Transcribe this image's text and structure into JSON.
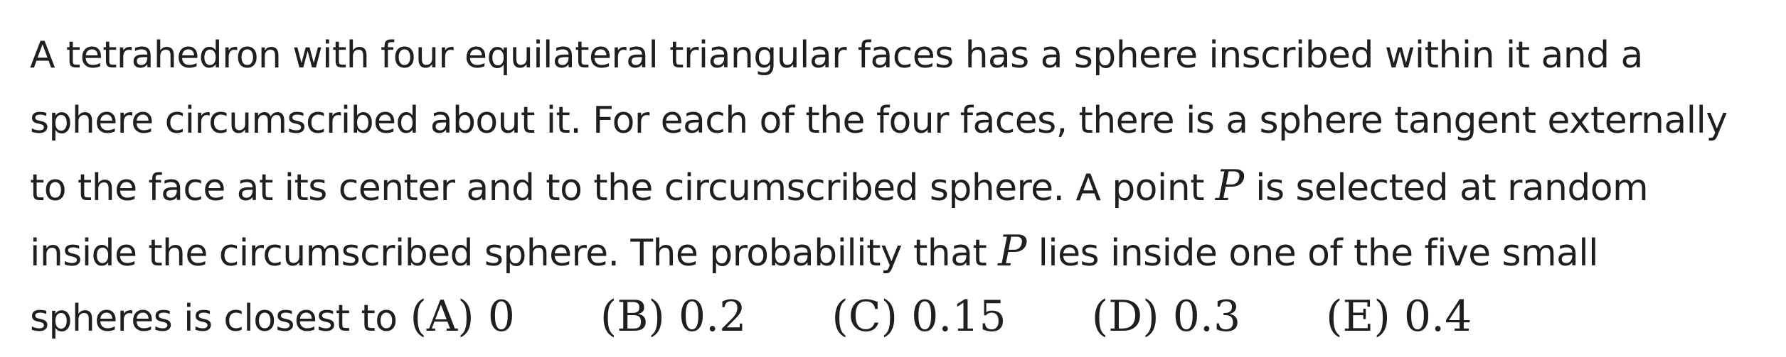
{
  "question": {
    "line1": "A tetrahedron with four equilateral triangular faces has a sphere inscribed within it and a",
    "line2": "sphere circumscribed about it. For each of the four faces, there is a sphere tangent externally",
    "line3_before": "to the face at its center and to the circumscribed sphere. A point ",
    "line3_var": "P",
    "line3_after": " is selected at random",
    "line4_before": "inside the circumscribed sphere. The probability that ",
    "line4_var": "P",
    "line4_after": " lies inside one of the five small",
    "line5_text": "spheres is closest to"
  },
  "choices": [
    {
      "label": "(A) 0"
    },
    {
      "label": "(B) 0.2"
    },
    {
      "label": "(C) 0.15"
    },
    {
      "label": "(D) 0.3"
    },
    {
      "label": "(E) 0.4"
    }
  ]
}
